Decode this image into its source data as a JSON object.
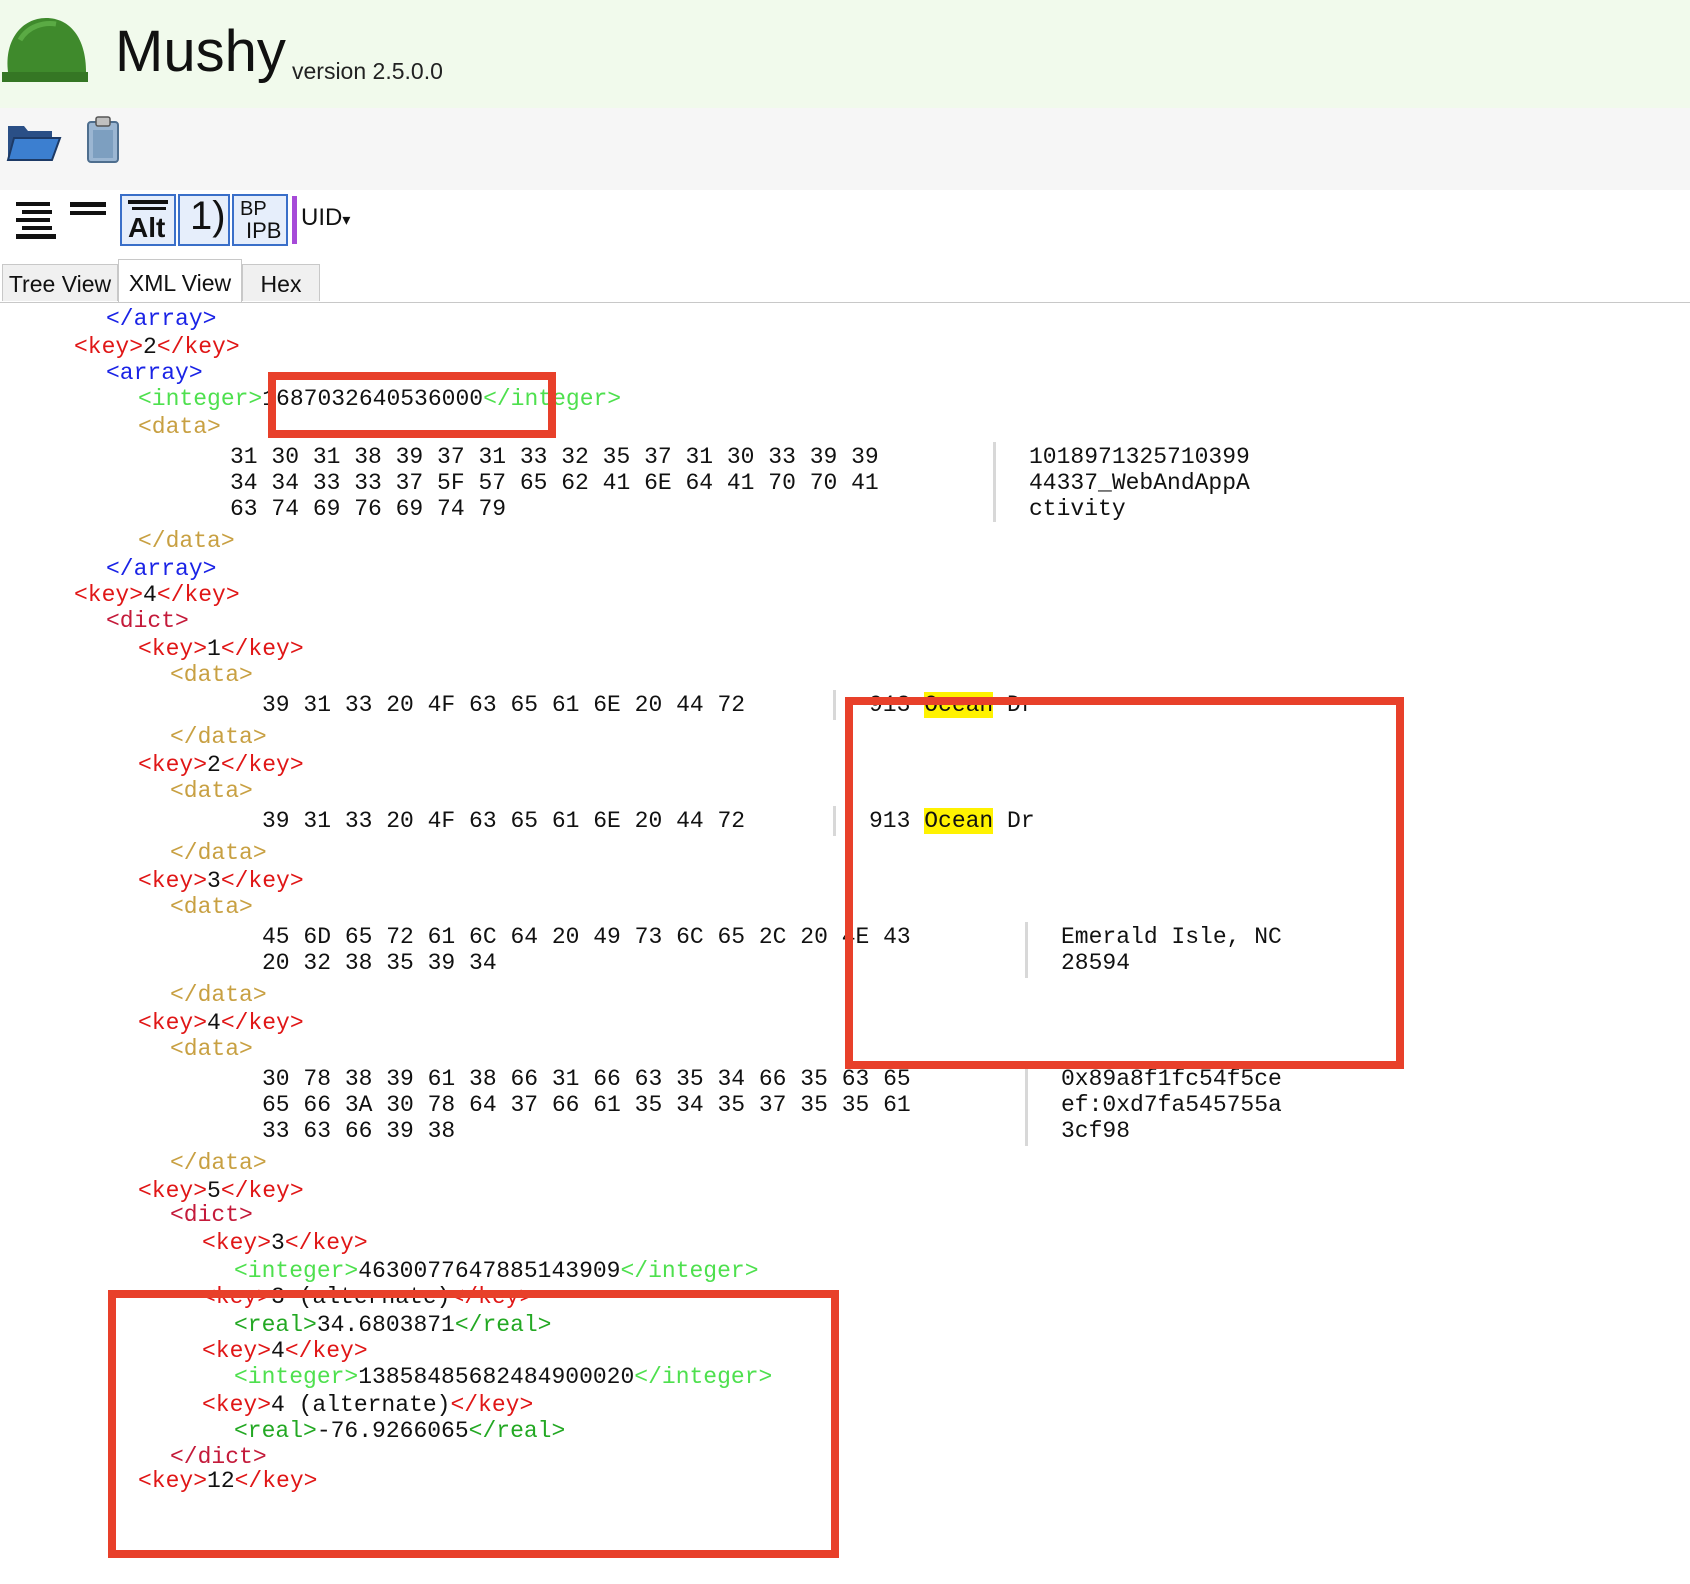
{
  "app": {
    "name": "Mushy",
    "version": "version 2.5.0.0"
  },
  "toolbar": {
    "open_icon": "folder-open-icon",
    "clipboard_icon": "clipboard-icon",
    "btn_alt": "Alt",
    "btn_paren": "1)",
    "btn_bp_top": "BP",
    "btn_bp_bottom": "IPB",
    "uid_label": "UID",
    "uid_arrow": "▾"
  },
  "tabs": [
    {
      "label": "Tree View"
    },
    {
      "label": "XML View"
    },
    {
      "label": "Hex"
    }
  ],
  "code": {
    "l1": "</array>",
    "l2_open": "<key>",
    "l2_val": "2",
    "l2_close": "</key>",
    "l3": "<array>",
    "l4_open": "<integer>",
    "l4_val": "1687032640536000",
    "l4_close": "</integer>",
    "l5": "<data>",
    "hex1": [
      "31 30 31 38 39 37 31 33 32 35 37 31 30 33 39 39",
      "34 34 33 33 37 5F 57 65 62 41 6E 64 41 70 70 41",
      "63 74 69 76 69 74 79"
    ],
    "ascii1": [
      "1018971325710399",
      "44337_WebAndAppA",
      "ctivity"
    ],
    "l9": "</data>",
    "l10": "</array>",
    "l11_open": "<key>",
    "l11_val": "4",
    "l11_close": "</key>",
    "l12": "<dict>",
    "k1_open": "<key>",
    "k1_val": "1",
    "k1_close": "</key>",
    "d_open": "<data>",
    "d_close": "</data>",
    "hex_k1": "39 31 33 20 4F 63 65 61 6E 20 44 72",
    "ascii_k1": {
      "a": "913 ",
      "b": "Ocean",
      "c": " Dr"
    },
    "k2_val": "2",
    "hex_k2": "39 31 33 20 4F 63 65 61 6E 20 44 72",
    "ascii_k2": {
      "a": "913 ",
      "b": "Ocean",
      "c": " Dr"
    },
    "k3_val": "3",
    "hex_k3": [
      "45 6D 65 72 61 6C 64 20 49 73 6C 65 2C 20 4E 43",
      "20 32 38 35 39 34"
    ],
    "ascii_k3": [
      "Emerald Isle, NC",
      "28594"
    ],
    "k4_val": "4",
    "hex_k4": [
      "30 78 38 39 61 38 66 31 66 63 35 34 66 35 63 65",
      "65 66 3A 30 78 64 37 66 61 35 34 35 37 35 35 61",
      "33 63 66 39 38"
    ],
    "ascii_k4": [
      "0x89a8f1fc54f5ce",
      "ef:0xd7fa545755a",
      "3cf98"
    ],
    "k5_val": "5",
    "dict_open": "<dict>",
    "n1_val": "3",
    "n1_int_open": "<integer>",
    "n1_int": "4630077647885143909",
    "n1_int_close": "</integer>",
    "n2_val": "3 (alternate)",
    "n2_real_open": "<real>",
    "n2_real": "34.6803871",
    "n2_real_close": "</real>",
    "n3_val": "4",
    "n3_int": "13858485682484900020",
    "n4_val": "4 (alternate)",
    "n4_real": "-76.9266065",
    "dict_close": "</dict>",
    "last_open": "<key>",
    "last_val": "12",
    "last_close": "</key>"
  }
}
